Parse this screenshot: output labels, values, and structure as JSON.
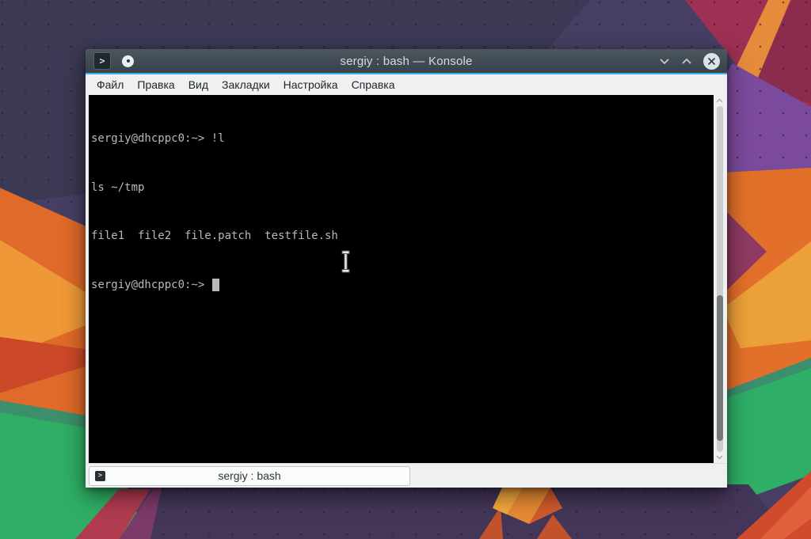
{
  "window": {
    "title": "sergiy : bash — Konsole",
    "app_icon_glyph": ">",
    "menu_items": [
      "Файл",
      "Правка",
      "Вид",
      "Закладки",
      "Настройка",
      "Справка"
    ]
  },
  "terminal": {
    "lines": [
      "sergiy@dhcppc0:~> !l",
      "ls ~/tmp",
      "file1  file2  file.patch  testfile.sh"
    ],
    "prompt": "sergiy@dhcppc0:~> "
  },
  "tab_bar": {
    "active_tab_label": "sergiy : bash",
    "tab_icon_glyph": ">"
  },
  "colors": {
    "accent_line": "#3daee9",
    "titlebar_top": "#4b565e",
    "titlebar_bottom": "#39424a",
    "menubar_bg": "#eff0f1",
    "terminal_bg": "#000000",
    "terminal_fg": "#b9b9b9",
    "scrollbar_thumb": "#75797c",
    "wallpaper_purple": "#473f63",
    "wallpaper_dark_navy": "#3b3954",
    "wallpaper_orange": "#df6a29",
    "wallpaper_green": "#2fae65",
    "wallpaper_magenta": "#9d3053"
  }
}
